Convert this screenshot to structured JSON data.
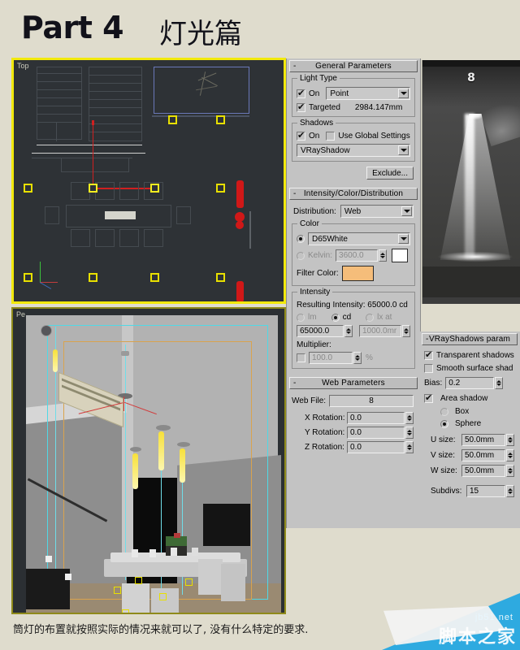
{
  "title": {
    "part": "Part 4",
    "chinese": "灯光篇"
  },
  "viewports": {
    "top": {
      "label": "Top"
    },
    "perspective": {
      "label": "Pe"
    }
  },
  "light_preview": {
    "number": "8"
  },
  "command_panel": {
    "general_parameters": {
      "rollout_title": "General Parameters",
      "minus": "-",
      "light_type": {
        "group_label": "Light Type",
        "on_label": "On",
        "on_checked": true,
        "type_value": "Point",
        "targeted_label": "Targeted",
        "targeted_checked": true,
        "targeted_value": "2984.147mm"
      },
      "shadows": {
        "group_label": "Shadows",
        "on_label": "On",
        "on_checked": true,
        "use_global_label": "Use Global Settings",
        "use_global_checked": false,
        "shadow_type_value": "VRayShadow",
        "exclude_label": "Exclude..."
      }
    },
    "intensity_color_distribution": {
      "rollout_title": "Intensity/Color/Distribution",
      "minus": "-",
      "distribution_label": "Distribution:",
      "distribution_value": "Web",
      "color": {
        "group_label": "Color",
        "preset_selected": true,
        "preset_value": "D65White",
        "kelvin_label": "Kelvin:",
        "kelvin_selected": false,
        "kelvin_value": "3600.0",
        "kelvin_swatch": "#ffffff",
        "filter_color_label": "Filter Color:",
        "filter_color_swatch": "#f5bd7a"
      },
      "intensity": {
        "group_label": "Intensity",
        "resulting_label": "Resulting Intensity: 65000.0 cd",
        "unit_lm": "lm",
        "unit_cd": "cd",
        "unit_lx": "lx at",
        "unit_selected": "cd",
        "value": "65000.0",
        "lx_distance": "1000.0mr",
        "multiplier_label": "Multiplier:",
        "multiplier_checked": false,
        "multiplier_value": "100.0",
        "percent_symbol": "%"
      }
    },
    "web_parameters": {
      "rollout_title": "Web Parameters",
      "minus": "-",
      "web_file_label": "Web File:",
      "web_file_value": "8",
      "x_rotation_label": "X Rotation:",
      "x_rotation_value": "0.0",
      "y_rotation_label": "Y Rotation:",
      "y_rotation_value": "0.0",
      "z_rotation_label": "Z Rotation:",
      "z_rotation_value": "0.0"
    }
  },
  "shadow_panel": {
    "rollout_title": "VRayShadows param",
    "minus": "-",
    "transparent_label": "Transparent shadows",
    "transparent_checked": true,
    "smooth_label": "Smooth surface shad",
    "smooth_checked": false,
    "bias_label": "Bias:",
    "bias_value": "0.2",
    "area_shadow_label": "Area shadow",
    "area_shadow_checked": true,
    "box_label": "Box",
    "sphere_label": "Sphere",
    "shape_selected": "Sphere",
    "u_size_label": "U size:",
    "u_size_value": "50.0mm",
    "v_size_label": "V size:",
    "v_size_value": "50.0mm",
    "w_size_label": "W size:",
    "w_size_value": "50.0mm",
    "subdivs_label": "Subdivs:",
    "subdivs_value": "15"
  },
  "caption": "筒灯的布置就按照实际的情况来就可以了, 没有什么特定的要求.",
  "watermark": {
    "url": "jb51.net",
    "name": "脚本之家"
  },
  "colors": {
    "page_background": "#dfdccd",
    "panel_background": "#c3c3c3",
    "viewport_active_border": "#f2e90c",
    "light_marker": "#e8e000",
    "filter_color": "#f5bd7a",
    "watermark_blue": "#2eaae0"
  }
}
